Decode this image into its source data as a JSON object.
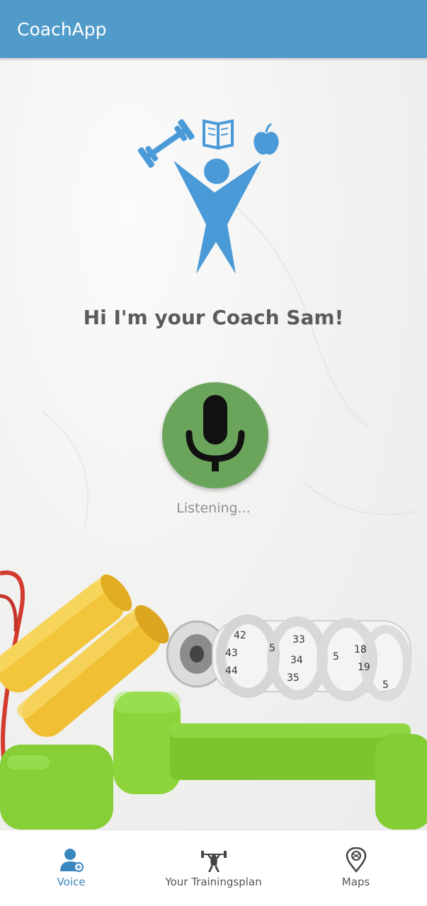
{
  "app_bar": {
    "title": "CoachApp"
  },
  "main": {
    "greeting": "Hi I'm your Coach Sam!",
    "status": "Listening...",
    "mic_button_color": "#6ba55c"
  },
  "bottom_nav": {
    "items": [
      {
        "label": "Voice",
        "icon": "coach-person-icon",
        "active": true
      },
      {
        "label": "Your Trainingsplan",
        "icon": "weightlifter-icon",
        "active": false
      },
      {
        "label": "Maps",
        "icon": "map-pin-icon",
        "active": false
      }
    ]
  },
  "colors": {
    "primary": "#519bcb",
    "logo_blue": "#4a9ad8",
    "active_nav": "#3a87c0",
    "mic_green": "#6ba55c"
  }
}
